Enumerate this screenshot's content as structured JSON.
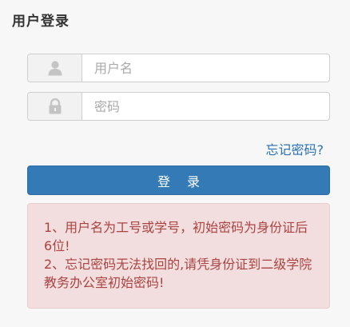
{
  "page": {
    "title": "用户登录"
  },
  "form": {
    "username_placeholder": "用户名",
    "password_placeholder": "密码",
    "forgot_link": "忘记密码?",
    "login_button": "登 录"
  },
  "icons": {
    "username": "user-icon",
    "password": "lock-icon"
  },
  "notice": {
    "line1": "1、用户名为工号或学号，初始密码为身份证后6位!",
    "line2": "2、忘记密码无法找回的,请凭身份证到二级学院教务办公室初始密码!"
  },
  "colors": {
    "primary": "#337ab7",
    "link": "#2a72b5",
    "notice_bg": "#f2dede",
    "notice_text": "#a94442"
  }
}
